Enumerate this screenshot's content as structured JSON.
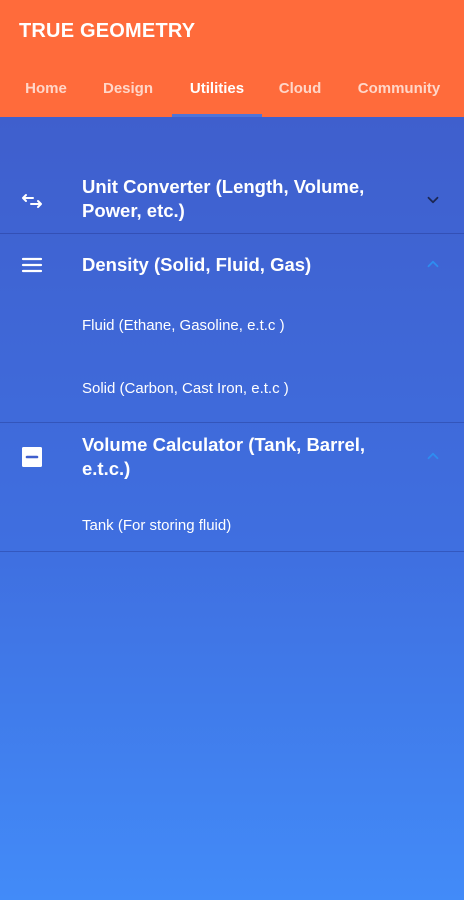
{
  "app": {
    "title": "TRUE GEOMETRY"
  },
  "tabs": [
    {
      "label": "Home"
    },
    {
      "label": "Design"
    },
    {
      "label": "Utilities"
    },
    {
      "label": "Cloud"
    },
    {
      "label": "Community"
    }
  ],
  "active_tab": "Utilities",
  "sections": [
    {
      "title": "Unit Converter (Length, Volume, Power, etc.)",
      "icon": "swap-arrows-icon",
      "expanded": false,
      "items": []
    },
    {
      "title": "Density (Solid, Fluid, Gas)",
      "icon": "menu-lines-icon",
      "expanded": true,
      "items": [
        {
          "label": "Fluid (Ethane, Gasoline, e.t.c )"
        },
        {
          "label": "Solid (Carbon, Cast Iron, e.t.c )"
        }
      ]
    },
    {
      "title": "Volume Calculator (Tank, Barrel, e.t.c.)",
      "icon": "minus-box-icon",
      "expanded": true,
      "items": [
        {
          "label": "Tank (For storing fluid)"
        }
      ]
    }
  ],
  "colors": {
    "header": "#ff6b3b",
    "accent": "#4f74d8",
    "content_top": "#3f5fcd",
    "content_bottom": "#428bf8"
  }
}
